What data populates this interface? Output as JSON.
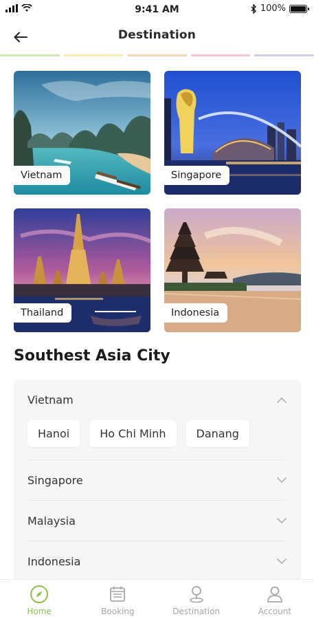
{
  "status_bar": {
    "time": "9:41 AM",
    "battery": "100%"
  },
  "header": {
    "title": "Destination"
  },
  "accent_strip_colors": [
    "#cfe5b4",
    "#f7ecb0",
    "#f6d6b9",
    "#f4c3d3",
    "#cfcbe8"
  ],
  "destinations": [
    {
      "label": "Vietnam",
      "icon": "vietnam-photo"
    },
    {
      "label": "Singapore",
      "icon": "singapore-photo"
    },
    {
      "label": "Thailand",
      "icon": "thailand-photo"
    },
    {
      "label": "Indonesia",
      "icon": "indonesia-photo"
    }
  ],
  "section": {
    "title": "Southest Asia City"
  },
  "accordion": [
    {
      "label": "Vietnam",
      "expanded": true,
      "cities": [
        "Hanoi",
        "Ho Chi Minh",
        "Danang"
      ]
    },
    {
      "label": "Singapore",
      "expanded": false
    },
    {
      "label": "Malaysia",
      "expanded": false
    },
    {
      "label": "Indonesia",
      "expanded": false
    }
  ],
  "bottom_nav": [
    {
      "label": "Home",
      "icon": "compass-icon",
      "active": true
    },
    {
      "label": "Booking",
      "icon": "calendar-icon",
      "active": false
    },
    {
      "label": "Destination",
      "icon": "location-pin-icon",
      "active": false
    },
    {
      "label": "Account",
      "icon": "user-icon",
      "active": false
    }
  ],
  "colors": {
    "accent": "#8bc34a",
    "inactive": "#a6a6a6",
    "panel": "#f6f6f6"
  }
}
